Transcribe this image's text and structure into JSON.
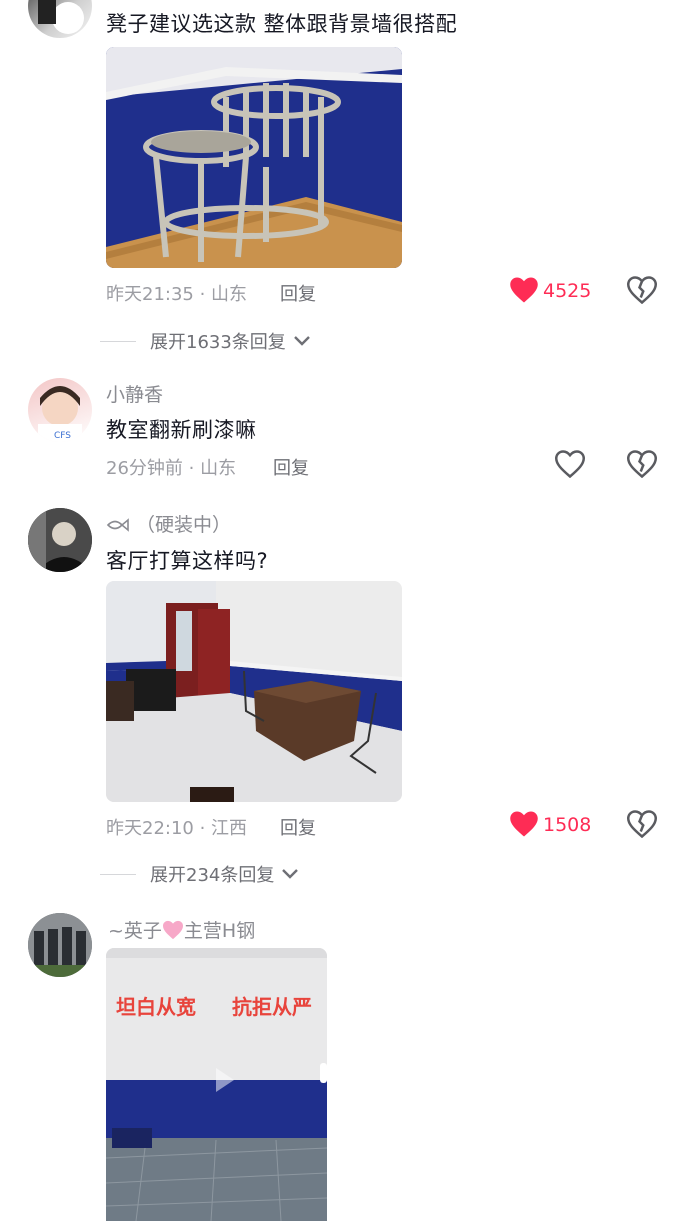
{
  "comments": [
    {
      "text": "凳子建议选这款 整体跟背景墙很搭配",
      "time": "昨天21:35",
      "location": "山东",
      "reply": "回复",
      "likes": "4525",
      "liked": true,
      "expand": "展开1633条回复"
    },
    {
      "username": "小静香",
      "text": "教室翻新刷漆嘛",
      "time": "26分钟前",
      "location": "山东",
      "reply": "回复"
    },
    {
      "username": "（硬装中）",
      "text": "客厅打算这样吗?",
      "time": "昨天22:10",
      "location": "江西",
      "reply": "回复",
      "likes": "1508",
      "liked": true,
      "expand": "展开234条回复"
    },
    {
      "username_prefix": "~英子",
      "username_suffix": "主营H钢",
      "image_slogan_left": "坦白从宽",
      "image_slogan_right": "抗拒从严"
    }
  ],
  "colors": {
    "like_red": "#fe2c55",
    "gray_text": "#9c9da3"
  },
  "icons": [
    "heart-filled-icon",
    "heart-outline-icon",
    "broken-heart-icon",
    "chevron-down-icon",
    "fish-icon",
    "pink-heart-icon"
  ]
}
